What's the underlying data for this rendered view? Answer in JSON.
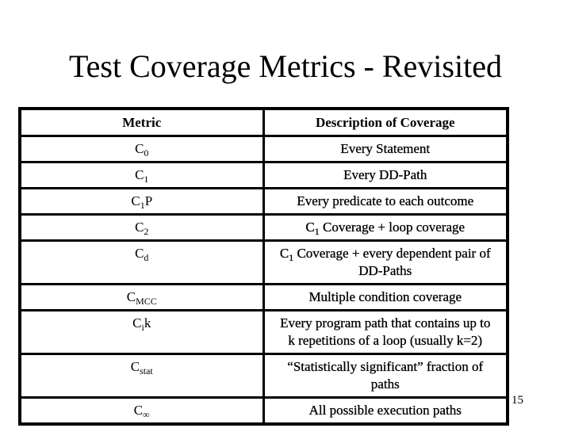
{
  "slide": {
    "title": "Test Coverage Metrics - Revisited",
    "page_number": "15"
  },
  "table": {
    "headers": {
      "metric": "Metric",
      "description": "Description of Coverage"
    },
    "rows": [
      {
        "metric_base": "C",
        "metric_sub": "0",
        "metric_suffix": "",
        "desc_prefix_base": "",
        "desc_prefix_sub": "",
        "description": "Every Statement",
        "description_line2": ""
      },
      {
        "metric_base": "C",
        "metric_sub": "1",
        "metric_suffix": "",
        "desc_prefix_base": "",
        "desc_prefix_sub": "",
        "description": "Every DD-Path",
        "description_line2": ""
      },
      {
        "metric_base": "C",
        "metric_sub": "1",
        "metric_suffix": "P",
        "desc_prefix_base": "",
        "desc_prefix_sub": "",
        "description": "Every predicate to each outcome",
        "description_line2": ""
      },
      {
        "metric_base": "C",
        "metric_sub": "2",
        "metric_suffix": "",
        "desc_prefix_base": "C",
        "desc_prefix_sub": "1",
        "description": " Coverage + loop coverage",
        "description_line2": ""
      },
      {
        "metric_base": "C",
        "metric_sub": "d",
        "metric_suffix": "",
        "desc_prefix_base": "C",
        "desc_prefix_sub": "1",
        "description": " Coverage + every dependent pair of",
        "description_line2": "DD-Paths"
      },
      {
        "metric_base": "C",
        "metric_sub": "MCC",
        "metric_suffix": "",
        "desc_prefix_base": "",
        "desc_prefix_sub": "",
        "description": "Multiple condition coverage",
        "description_line2": ""
      },
      {
        "metric_base": "C",
        "metric_sub": "i",
        "metric_suffix": "k",
        "desc_prefix_base": "",
        "desc_prefix_sub": "",
        "description": "Every program path that contains up to",
        "description_line2": "k repetitions of a loop (usually k=2)"
      },
      {
        "metric_base": "C",
        "metric_sub": "stat",
        "metric_suffix": "",
        "desc_prefix_base": "",
        "desc_prefix_sub": "",
        "description": "“Statistically significant” fraction of",
        "description_line2": "paths"
      },
      {
        "metric_base": "C",
        "metric_sub": "∞",
        "metric_suffix": "",
        "desc_prefix_base": "",
        "desc_prefix_sub": "",
        "description": "All possible execution paths",
        "description_line2": ""
      }
    ]
  }
}
